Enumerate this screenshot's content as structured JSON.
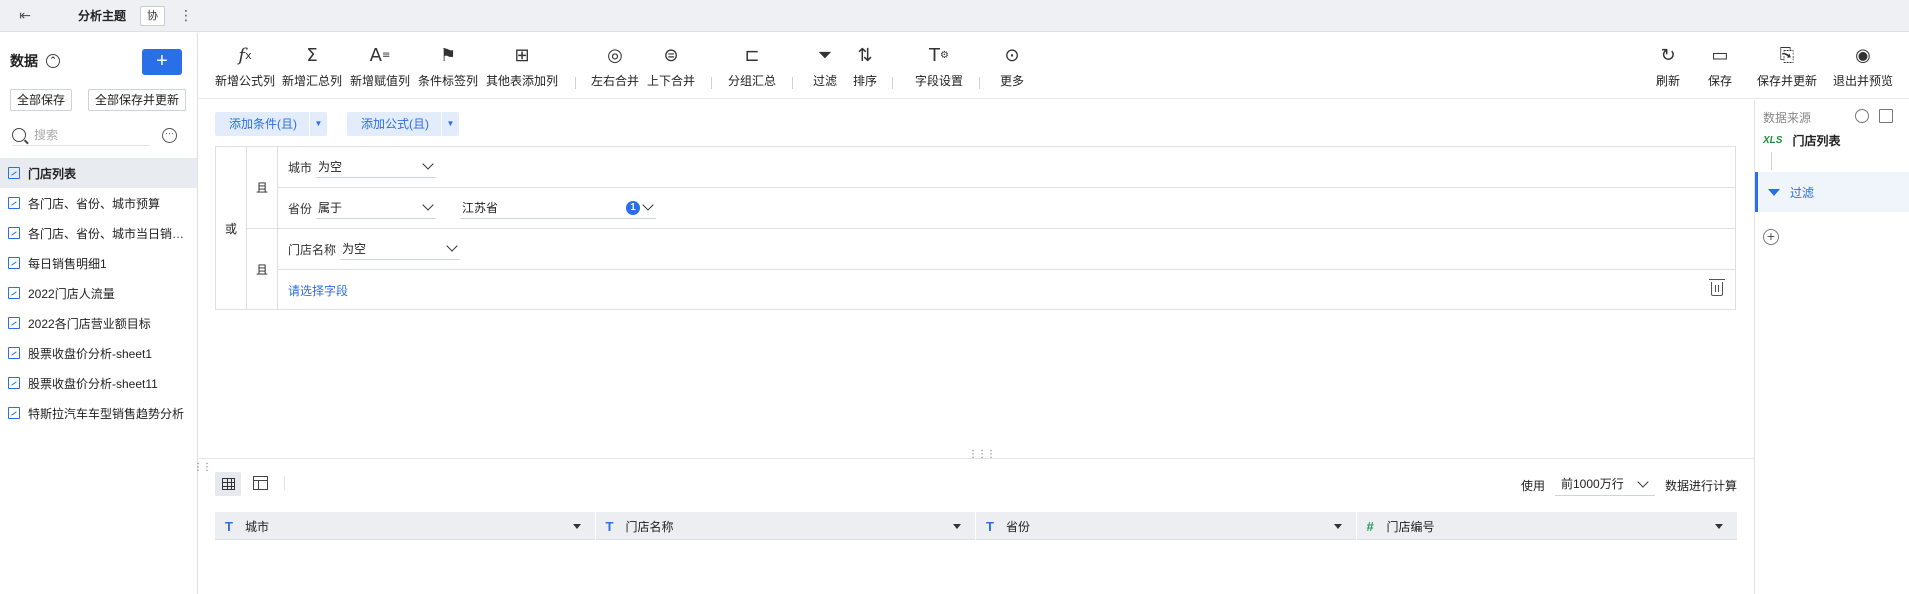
{
  "topbar": {
    "title": "分析主题",
    "collab": "协"
  },
  "sidebar": {
    "header": "数据",
    "save_all": "全部保存",
    "save_all_update": "全部保存并更新",
    "search_placeholder": "搜索",
    "items": [
      {
        "label": "门店列表",
        "active": true
      },
      {
        "label": "各门店、省份、城市预算"
      },
      {
        "label": "各门店、省份、城市当日销售额"
      },
      {
        "label": "每日销售明细1"
      },
      {
        "label": "2022门店人流量"
      },
      {
        "label": "2022各门店营业额目标"
      },
      {
        "label": "股票收盘价分析-sheet1"
      },
      {
        "label": "股票收盘价分析-sheet11"
      },
      {
        "label": "特斯拉汽车车型销售趋势分析"
      }
    ]
  },
  "toolbar": {
    "left": [
      {
        "label": "新增公式列",
        "icon": "fx-icon"
      },
      {
        "label": "新增汇总列",
        "icon": "sigma-icon"
      },
      {
        "label": "新增赋值列",
        "icon": "assign-icon"
      },
      {
        "label": "条件标签列",
        "icon": "tag-icon"
      },
      {
        "label": "其他表添加列",
        "icon": "add-col-icon"
      },
      {
        "label": "左右合并",
        "icon": "merge-lr-icon"
      },
      {
        "label": "上下合并",
        "icon": "merge-tb-icon"
      },
      {
        "label": "分组汇总",
        "icon": "group-icon"
      },
      {
        "label": "过滤",
        "icon": "filter-icon"
      },
      {
        "label": "排序",
        "icon": "sort-icon"
      },
      {
        "label": "字段设置",
        "icon": "field-settings-icon"
      },
      {
        "label": "更多",
        "icon": "more-icon"
      }
    ],
    "right": [
      {
        "label": "刷新",
        "icon": "refresh-icon"
      },
      {
        "label": "保存",
        "icon": "save-icon"
      },
      {
        "label": "保存并更新",
        "icon": "save-update-icon"
      },
      {
        "label": "退出并预览",
        "icon": "preview-icon"
      }
    ]
  },
  "conditions": {
    "add_condition": "添加条件(且)",
    "add_formula": "添加公式(且)",
    "or_label": "或",
    "and_label": "且",
    "rows": [
      {
        "field": "城市",
        "operator": "为空"
      },
      {
        "field": "省份",
        "operator": "属于",
        "value": "江苏省",
        "count": "1"
      },
      {
        "field": "门店名称",
        "operator": "为空"
      }
    ],
    "pick_field": "请选择字段"
  },
  "right_panel": {
    "title": "数据来源",
    "source_type": "XLS",
    "source_name": "门店列表",
    "step": "过滤"
  },
  "preview": {
    "use_label": "使用",
    "rows_option": "前1000万行",
    "calc_label": "数据进行计算",
    "columns": [
      {
        "name": "城市",
        "type": "T"
      },
      {
        "name": "门店名称",
        "type": "T"
      },
      {
        "name": "省份",
        "type": "T"
      },
      {
        "name": "门店编号",
        "type": "#"
      }
    ]
  },
  "colors": {
    "accent": "#2a6ee8",
    "excel": "#1f8f3a",
    "number_type": "#1f9c5a"
  }
}
